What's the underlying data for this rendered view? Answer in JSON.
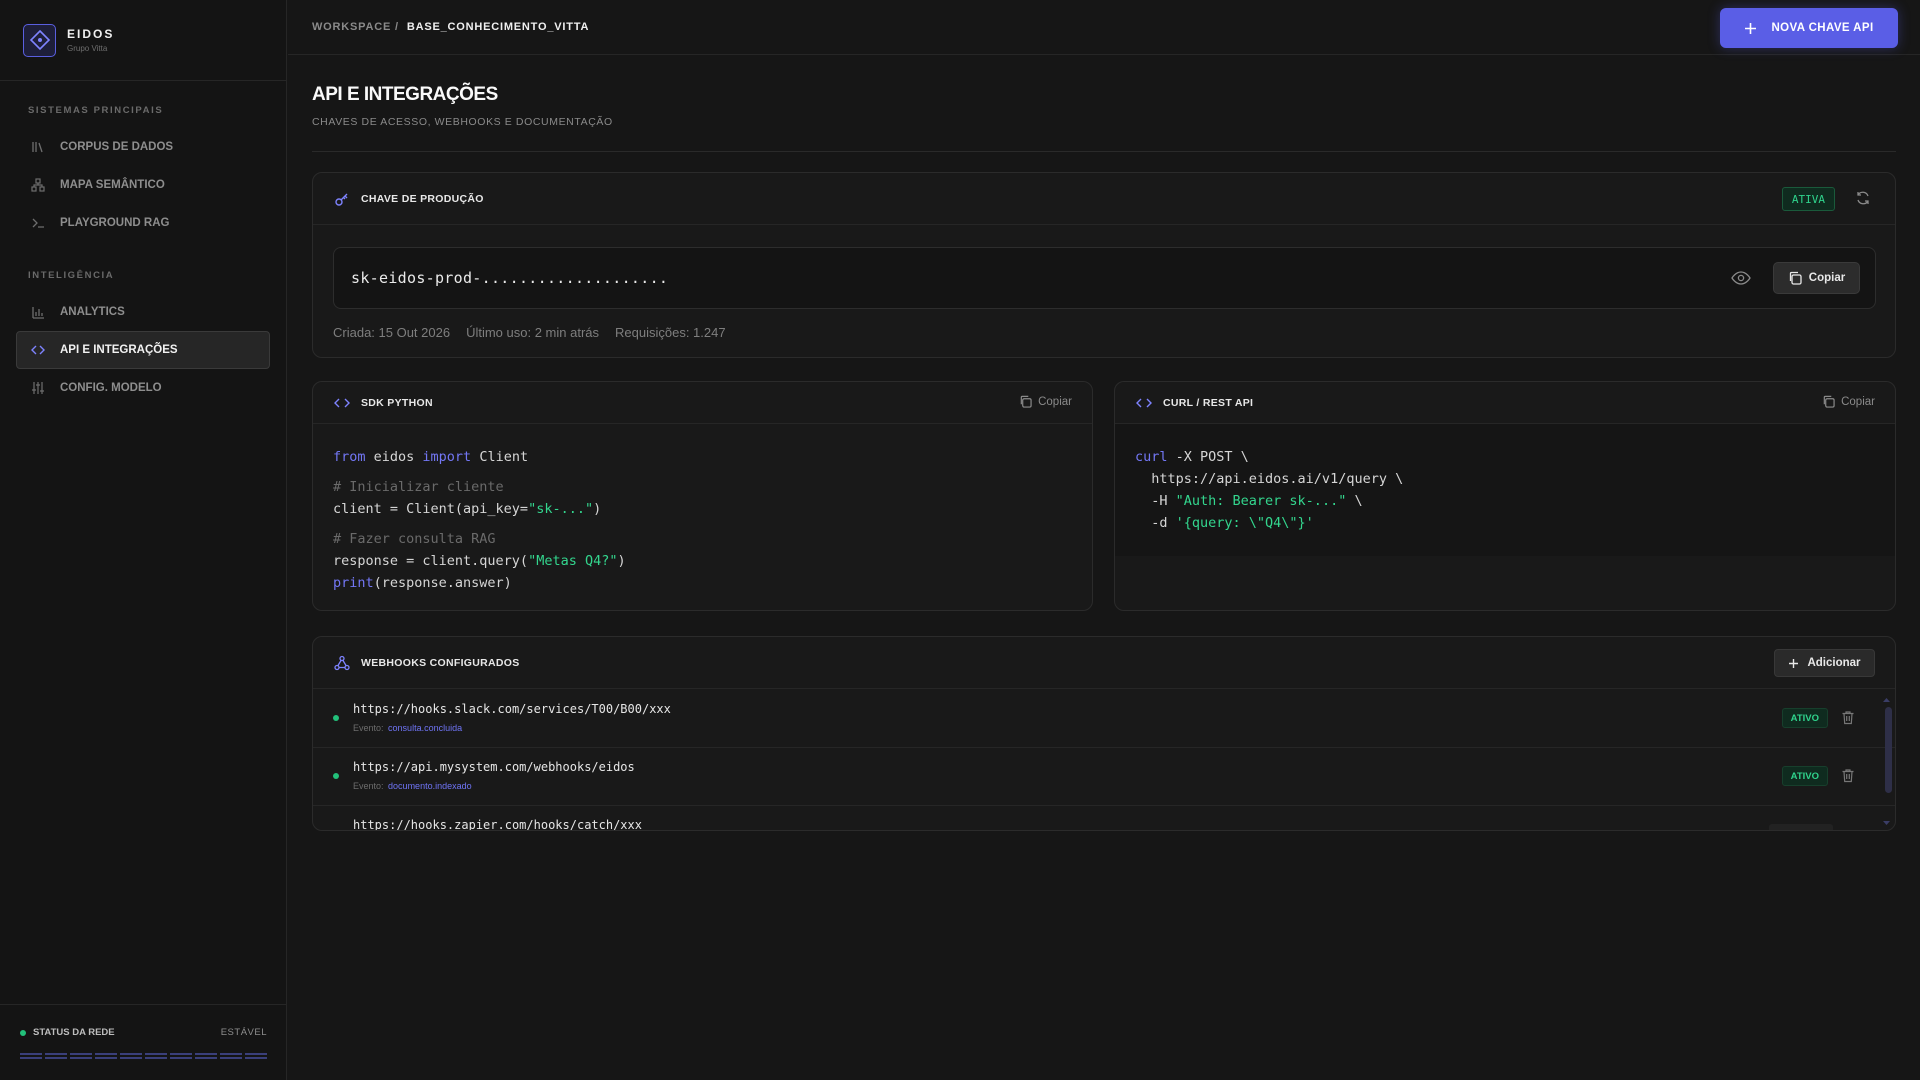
{
  "brand": {
    "name": "EIDOS",
    "subtitle": "Grupo Vitta"
  },
  "sidebar": {
    "sections": [
      {
        "title": "SISTEMAS PRINCIPAIS"
      },
      {
        "title": "INTELIGÊNCIA"
      }
    ],
    "items": [
      {
        "label": "CORPUS DE DADOS",
        "icon": "library-icon"
      },
      {
        "label": "MAPA SEMÂNTICO",
        "icon": "network-icon"
      },
      {
        "label": "PLAYGROUND RAG",
        "icon": "terminal-icon"
      },
      {
        "label": "ANALYTICS",
        "icon": "bar-chart-icon"
      },
      {
        "label": "API E INTEGRAÇÕES",
        "icon": "code-icon",
        "active": true
      },
      {
        "label": "CONFIG. MODELO",
        "icon": "sliders-icon"
      }
    ],
    "status": {
      "label": "STATUS DA REDE",
      "value": "ESTÁVEL"
    }
  },
  "topbar": {
    "breadcrumb_root": "WORKSPACE /",
    "breadcrumb_current": "BASE_CONHECIMENTO_VITTA",
    "new_key_button": "NOVA CHAVE API"
  },
  "page": {
    "title": "API E INTEGRAÇÕES",
    "subtitle": "CHAVES DE ACESSO, WEBHOOKS E DOCUMENTAÇÃO"
  },
  "production_key": {
    "title": "CHAVE DE PRODUÇÃO",
    "status": "ATIVA",
    "key_masked": "sk-eidos-prod-....................",
    "copy_label": "Copiar",
    "created": "Criada: 15 Out 2026",
    "last_use": "Último uso: 2 min atrás",
    "requests": "Requisições: 1.247"
  },
  "sdk_python": {
    "title": "SDK PYTHON",
    "copy_label": "Copiar"
  },
  "curl": {
    "title": "CURL / REST API",
    "copy_label": "Copiar"
  },
  "webhooks": {
    "title": "WEBHOOKS CONFIGURADOS",
    "add_label": "Adicionar",
    "event_prefix": "Evento:",
    "items": [
      {
        "url": "https://hooks.slack.com/services/T00/B00/xxx",
        "event": "consulta.concluida",
        "status": "ATIVO"
      },
      {
        "url": "https://api.mysystem.com/webhooks/eidos",
        "event": "documento.indexado",
        "status": "ATIVO"
      },
      {
        "url": "https://hooks.zapier.com/hooks/catch/xxx"
      }
    ]
  },
  "colors": {
    "accent": "#5a5ee6",
    "success": "#2fd38c",
    "background": "#161616"
  }
}
